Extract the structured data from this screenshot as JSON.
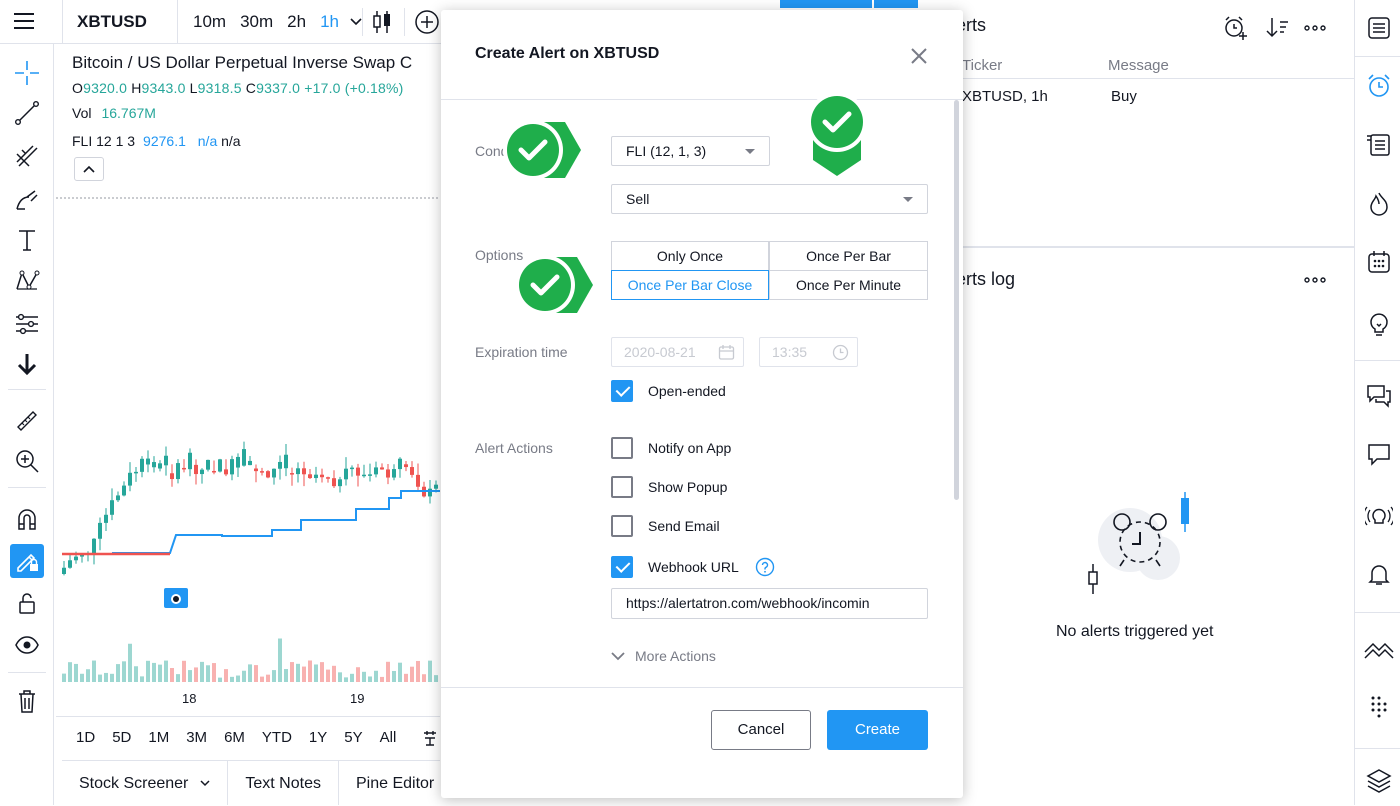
{
  "colors": {
    "accent": "#2196f3",
    "up": "#26a69a",
    "down": "#ef5350",
    "annotation": "#1fae4b"
  },
  "toolbar": {
    "symbol": "XBTUSD",
    "intervals": [
      "10m",
      "30m",
      "2h",
      "1h"
    ],
    "active_interval": "1h"
  },
  "chart": {
    "title": "Bitcoin / US Dollar Perpetual Inverse Swap C",
    "ohlc": {
      "o_label": "O",
      "o": "9320.0",
      "h_label": "H",
      "h": "9343.0",
      "l_label": "L",
      "l": "9318.5",
      "c_label": "C",
      "c": "9337.0",
      "change": "+17.0 (+0.18%)"
    },
    "vol_label": "Vol",
    "vol_value": "16.767M",
    "indicator_name": "FLI 12 1 3",
    "indicator_value": "9276.1",
    "indicator_na1": "n/a",
    "indicator_na2": "n/a",
    "x_labels": [
      "18",
      "19"
    ],
    "ranges": [
      "1D",
      "5D",
      "1M",
      "3M",
      "6M",
      "YTD",
      "1Y",
      "5Y",
      "All"
    ]
  },
  "bottom_tabs": [
    "Stock Screener",
    "Text Notes",
    "Pine Editor"
  ],
  "modal": {
    "title": "Create Alert on XBTUSD",
    "condition_label": "Condition",
    "condition_select": "FLI (12, 1, 3)",
    "condition_value": "Sell",
    "options_label": "Options",
    "options": [
      "Only Once",
      "Once Per Bar",
      "Once Per Bar Close",
      "Once Per Minute"
    ],
    "active_option": "Once Per Bar Close",
    "expiration_label": "Expiration time",
    "expiration_date": "2020-08-21",
    "expiration_time": "13:35",
    "open_ended_label": "Open-ended",
    "alert_actions_label": "Alert Actions",
    "actions": [
      {
        "label": "Notify on App",
        "checked": false
      },
      {
        "label": "Show Popup",
        "checked": false
      },
      {
        "label": "Send Email",
        "checked": false
      },
      {
        "label": "Webhook URL",
        "checked": true
      }
    ],
    "webhook_url": "https://alertatron.com/webhook/incomin",
    "more_actions": "More Actions",
    "cancel": "Cancel",
    "create": "Create"
  },
  "alerts_panel": {
    "title": "Alerts",
    "columns": [
      "Ticker",
      "Message"
    ],
    "rows": [
      {
        "ticker": "XBTUSD, 1h",
        "message": "Buy"
      }
    ],
    "log_title": "Alerts log",
    "empty_text": "No alerts triggered yet"
  }
}
